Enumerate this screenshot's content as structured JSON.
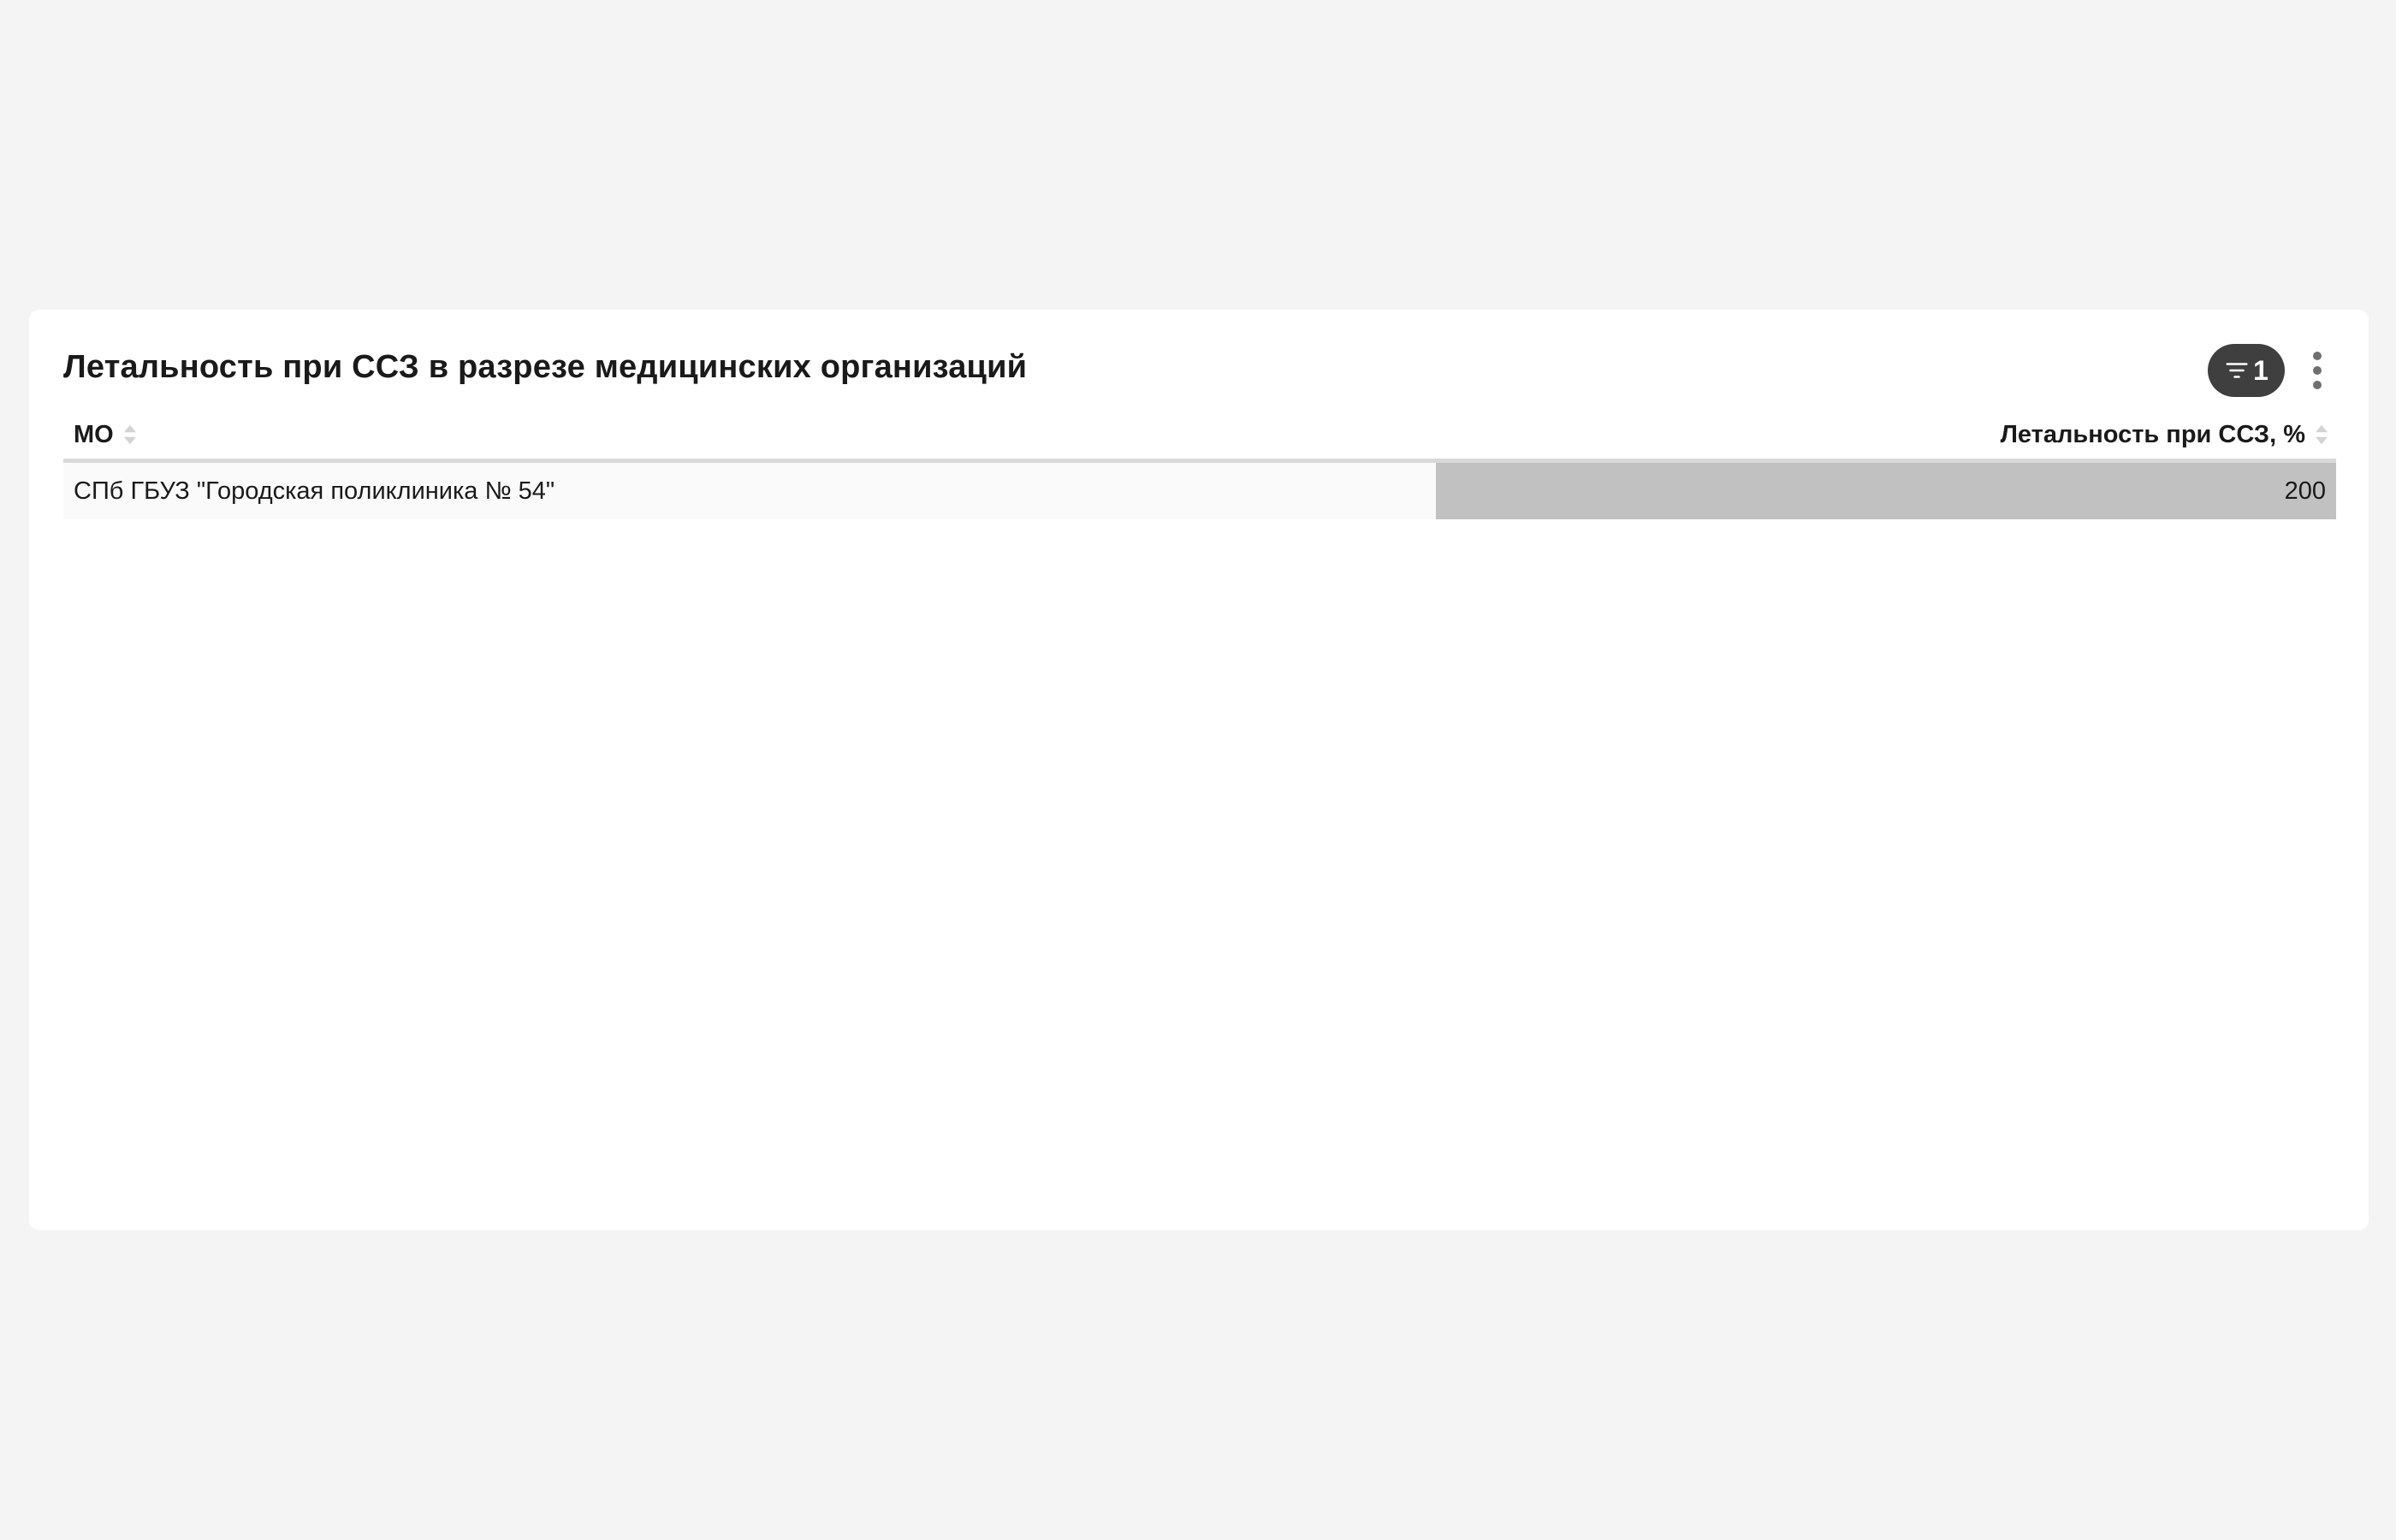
{
  "widget": {
    "title": "Летальность при ССЗ в разрезе медицинских организаций",
    "filter_count": "1",
    "filter_icon": "filter-icon",
    "more_icon": "more-vertical-icon"
  },
  "table": {
    "columns": [
      {
        "label": "МО",
        "sort_icon": "sort-icon"
      },
      {
        "label": "Летальность при ССЗ, %",
        "sort_icon": "sort-icon"
      }
    ],
    "rows": [
      {
        "mo": "СПб ГБУЗ \"Городская поликлиника № 54\"",
        "value": "200",
        "bar_fraction": 1.0
      }
    ]
  },
  "colors": {
    "page_bg": "#f4f4f4",
    "card_bg": "#ffffff",
    "badge_bg": "#3f3f3f",
    "bar_fill": "#c1c1c1",
    "row_bg": "#fafafa"
  }
}
